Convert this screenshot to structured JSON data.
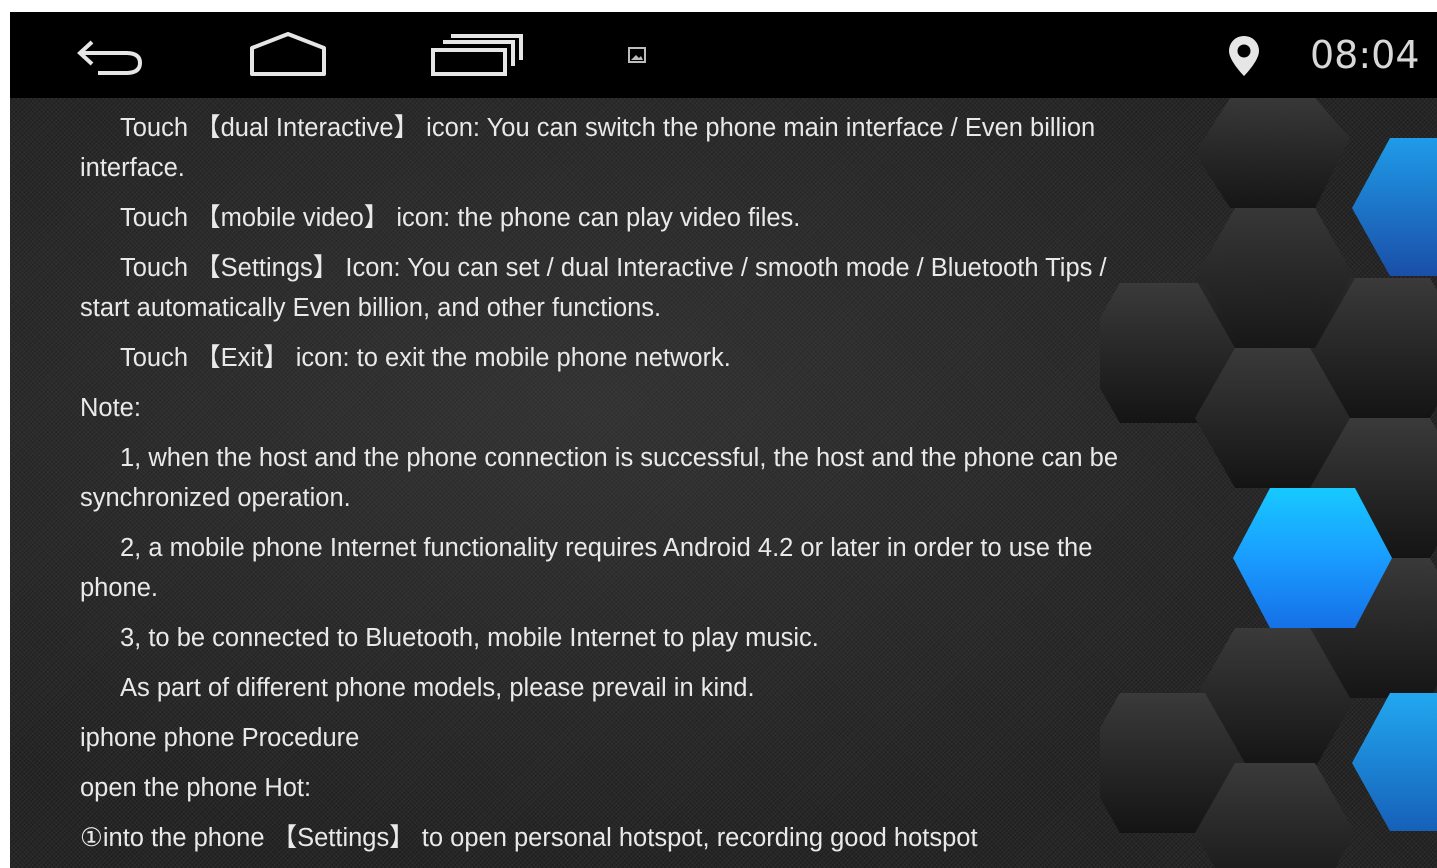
{
  "status_bar": {
    "time": "08:04"
  },
  "nav": {
    "icons": [
      "back-icon",
      "home-icon",
      "recent-apps-icon",
      "image-notification-icon",
      "location-icon"
    ]
  },
  "colors": {
    "nav_background": "#000000",
    "text": "#e9e9e9",
    "accent_blue": "#1fa3ff"
  },
  "paragraphs": [
    "Touch 【dual Interactive】 icon: You can switch the phone main interface / Even billion interface.",
    "Touch 【mobile video】 icon: the phone can play video files.",
    "Touch 【Settings】 Icon: You can set / dual Interactive / smooth mode / Bluetooth Tips / start automatically Even billion, and other functions.",
    "Touch 【Exit】 icon: to exit the mobile phone network.",
    "Note:",
    "1, when the host and the phone connection is successful, the host and the phone can be synchronized operation.",
    "2, a mobile phone Internet functionality requires Android 4.2 or later in order to use the phone.",
    "3, to be connected to Bluetooth, mobile Internet to play music.",
    "As part of different phone models, please prevail in kind.",
    "iphone phone Procedure",
    "open the phone Hot:",
    "①into the phone 【Settings】 to open personal hotspot, recording good hotspot"
  ]
}
